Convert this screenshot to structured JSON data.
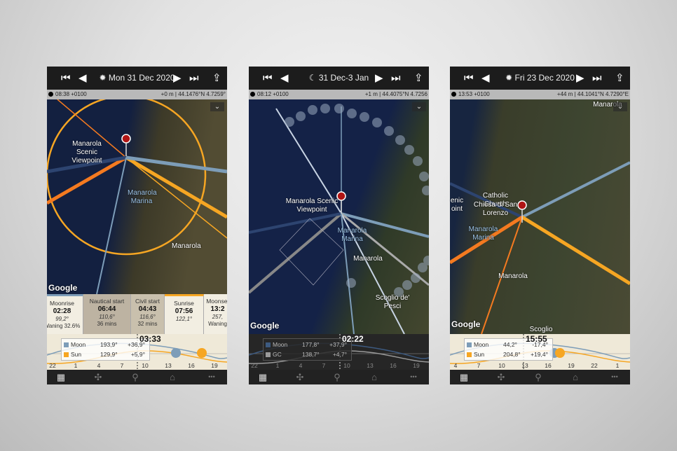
{
  "colors": {
    "sun": "#f6a623",
    "sunrise": "#f47a20",
    "moon": "#7d9db8",
    "moon_dark": "#2d4470",
    "gc": "#9a9a9a"
  },
  "phones": [
    {
      "header": {
        "date_icon": "sun-icon",
        "date": "Mon 31 Dec 2020"
      },
      "status": {
        "time": "08:38 +0100",
        "location": "+0 m | 44.1476°N 4.7259°"
      },
      "map": {
        "labels": [
          {
            "text": "Manarola Scenic Viewpoint",
            "style": ""
          },
          {
            "text": "Manarola Marina",
            "style": "blue"
          },
          {
            "text": "Manarola",
            "style": ""
          }
        ],
        "google": "Google"
      },
      "cards": [
        {
          "title": "Moonrise",
          "time": "02:28",
          "azimuth": "99,2°",
          "sub": "Waning 32.6%",
          "bar": "#7d9db8",
          "bg": "#f2eee2"
        },
        {
          "title": "Nautical start",
          "time": "06:44",
          "azimuth": "110,6°",
          "sub": "36 mins",
          "bar": "",
          "bg": "#bdb3a2"
        },
        {
          "title": "Civil start",
          "time": "04:43",
          "azimuth": "116,6°",
          "sub": "32 mins",
          "bar": "",
          "bg": "#c9c0ad"
        },
        {
          "title": "Sunrise",
          "time": "07:56",
          "azimuth": "122,1°",
          "sub": "",
          "bar": "#f6a623",
          "bg": "#f2eee2"
        },
        {
          "title": "Moonset",
          "time": "13:2",
          "azimuth": "257,",
          "sub": "Waning",
          "bar": "",
          "bg": "#f2eee2"
        }
      ],
      "timeline": {
        "theme": "light",
        "time": "03:33",
        "legend": [
          {
            "name": "Moon",
            "az": "193,9°",
            "el": "+36,9°",
            "color": "#7d9db8"
          },
          {
            "name": "Sun",
            "az": "129,9°",
            "el": "+5,9°",
            "color": "#f6a623"
          }
        ],
        "ticks": [
          "22",
          "1",
          "4",
          "7",
          "10",
          "13",
          "16",
          "19"
        ]
      }
    },
    {
      "header": {
        "date_icon": "moon-phase-icon",
        "date": "31 Dec-3 Jan"
      },
      "status": {
        "time": "08:12 +0100",
        "location": "+1 m | 44.4075°N 4.7256"
      },
      "map": {
        "labels": [
          {
            "text": "Manarola Scenic Viewpoint",
            "style": ""
          },
          {
            "text": "Manarola Marina",
            "style": "blue"
          },
          {
            "text": "Manarola",
            "style": ""
          },
          {
            "text": "Scoglio de' Pesci",
            "style": ""
          }
        ],
        "google": "Google"
      },
      "cards": [],
      "timeline": {
        "theme": "dark",
        "time": "02:22",
        "legend": [
          {
            "name": "Moon",
            "az": "177,8°",
            "el": "+37,9°",
            "color": "#3d5a80"
          },
          {
            "name": "GC",
            "az": "138,7°",
            "el": "+4,7°",
            "color": "#9a9a9a"
          }
        ],
        "ticks": [
          "22",
          "1",
          "4",
          "7",
          "10",
          "13",
          "16",
          "19"
        ]
      }
    },
    {
      "header": {
        "date_icon": "sun-icon",
        "date": "Fri 23 Dec 2020"
      },
      "status": {
        "time": "13:53 +0100",
        "location": "+44 m | 44.1041°N 4.7290°E"
      },
      "map": {
        "labels": [
          {
            "text": "Catholic Church",
            "style": ""
          },
          {
            "text": "Chiesa di San Lorenzo",
            "style": ""
          },
          {
            "text": "enic oint",
            "style": ""
          },
          {
            "text": "Manarola Marina",
            "style": "blue"
          },
          {
            "text": "Manarola",
            "style": ""
          },
          {
            "text": "Scoglio",
            "style": ""
          },
          {
            "text": "Manarola",
            "style": ""
          }
        ],
        "google": "Google"
      },
      "cards": [],
      "timeline": {
        "theme": "light",
        "time": "15:55",
        "legend": [
          {
            "name": "Moon",
            "az": "44,2°",
            "el": "-17,4°",
            "color": "#7d9db8"
          },
          {
            "name": "Sun",
            "az": "204,8°",
            "el": "+19,4°",
            "color": "#f6a623"
          }
        ],
        "ticks": [
          "4",
          "7",
          "10",
          "13",
          "16",
          "19",
          "22",
          "1"
        ]
      }
    }
  ],
  "tabbar": [
    {
      "name": "map",
      "glyph": "▦"
    },
    {
      "name": "3d-view",
      "glyph": "✣"
    },
    {
      "name": "search",
      "glyph": "⚲"
    },
    {
      "name": "planner",
      "glyph": "⌂"
    },
    {
      "name": "more",
      "glyph": "•••"
    }
  ],
  "nav": {
    "first": "⏮",
    "prev": "◀",
    "next": "▶",
    "last": "⏭",
    "share": "⇪",
    "chevron": "⌄"
  }
}
